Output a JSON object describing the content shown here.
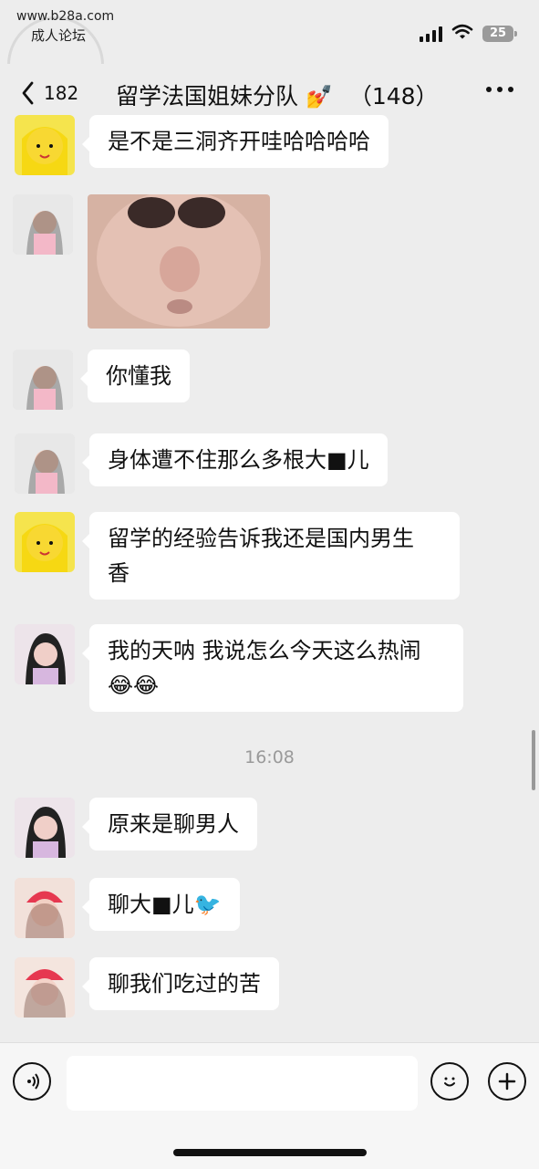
{
  "status_bar": {
    "watermark": "www.b28a.com",
    "carrier_text": "成人论坛",
    "battery": "25"
  },
  "nav": {
    "back_count": "182",
    "title": "留学法国姐妹分队",
    "member_count": "（148）"
  },
  "messages": [
    {
      "id": "m1",
      "avatar": "anime-girl",
      "type": "text",
      "lines": [
        "是不是三洞齐开哇哈哈哈哈"
      ]
    },
    {
      "id": "m2",
      "avatar": "girl-pink-top",
      "type": "image",
      "description": ""
    },
    {
      "id": "m3",
      "avatar": "girl-pink-top",
      "type": "text",
      "lines": [
        "你懂我"
      ]
    },
    {
      "id": "m4",
      "avatar": "girl-pink-top",
      "type": "text",
      "lines": [
        "身体遭不住那么多根大■儿"
      ]
    },
    {
      "id": "m5",
      "avatar": "anime-girl",
      "type": "text",
      "lines": [
        "留学的经验告诉我还是国内男生",
        "香"
      ]
    },
    {
      "id": "m6",
      "avatar": "girl-floral",
      "type": "text",
      "lines": [
        "我的天呐 我说怎么今天这么热闹",
        "😂😂"
      ]
    },
    {
      "id": "m7",
      "avatar": "girl-floral",
      "type": "text",
      "lines": [
        "原来是聊男人"
      ]
    },
    {
      "id": "m8",
      "avatar": "girl-red-beanie",
      "type": "text",
      "lines": [
        "聊大■儿🐦"
      ]
    },
    {
      "id": "m9",
      "avatar": "girl-red-hat",
      "type": "text",
      "lines": [
        "聊我们吃过的苦"
      ]
    }
  ],
  "timestamp": "16:08",
  "input": {
    "value": "",
    "placeholder": ""
  },
  "icons": {
    "back": "chevron-left-icon",
    "more": "more-horizontal-icon",
    "voice": "voice-icon",
    "emoji": "emoji-icon",
    "plus": "plus-icon"
  },
  "colors": {
    "background": "#ededed",
    "bubble": "#ffffff",
    "text": "#111111",
    "meta": "#9a9a9a"
  }
}
